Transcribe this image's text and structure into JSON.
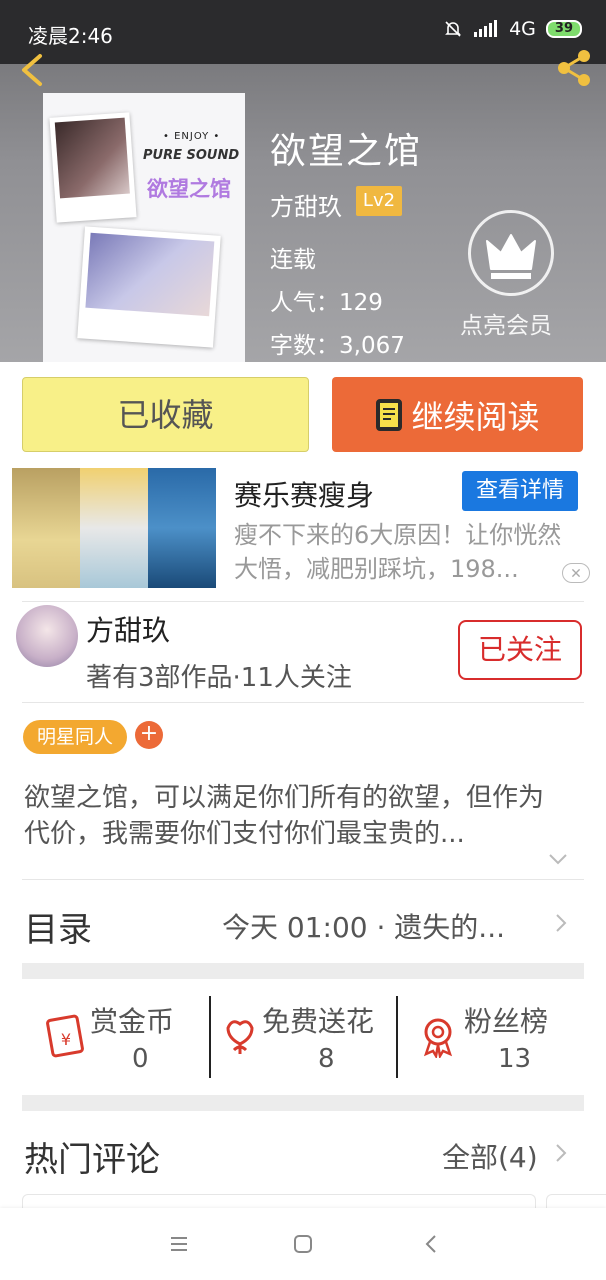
{
  "status_bar": {
    "time": "凌晨2:46",
    "network": "4G",
    "battery": "39"
  },
  "book": {
    "cover": {
      "enjoy": "• ENJOY •",
      "pure_sound": "PURE SOUND",
      "cover_title": "欲望之馆"
    },
    "title": "欲望之馆",
    "author": "方甜玖",
    "level": "Lv2",
    "status": "连载",
    "popularity": "人气：129",
    "word_count": "字数：3,067"
  },
  "vip": {
    "label": "点亮会员"
  },
  "actions": {
    "favorited_label": "已收藏",
    "continue_label": "继续阅读"
  },
  "ad": {
    "title": "赛乐赛瘦身",
    "button": "查看详情",
    "description": "瘦不下来的6大原因！让你恍然大悟，减肥别踩坑，198..."
  },
  "author_card": {
    "name": "方甜玖",
    "meta": "著有3部作品·11人关注",
    "follow_label": "已关注"
  },
  "tags": [
    {
      "label": "明星同人"
    }
  ],
  "tag_add": "+",
  "synopsis": " 欲望之馆，可以满足你们所有的欲望，但作为代价，我需要你们支付你们最宝贵的...",
  "toc": {
    "label": "目录",
    "latest": "今天 01:00 · 遗失的..."
  },
  "stats": [
    {
      "label": "赏金币",
      "value": "0",
      "icon": "red-envelope-icon"
    },
    {
      "label": "免费送花",
      "value": "8",
      "icon": "flower-icon"
    },
    {
      "label": "粉丝榜",
      "value": "13",
      "icon": "medal-icon"
    }
  ],
  "comments": {
    "label": "热门评论",
    "all_label": "全部(4)"
  },
  "colors": {
    "accent_orange": "#ec6a38",
    "favorite_yellow": "#f8f088",
    "follow_red": "#d82c2c",
    "ad_blue": "#1a78e0",
    "tag_orange": "#f3a830"
  }
}
